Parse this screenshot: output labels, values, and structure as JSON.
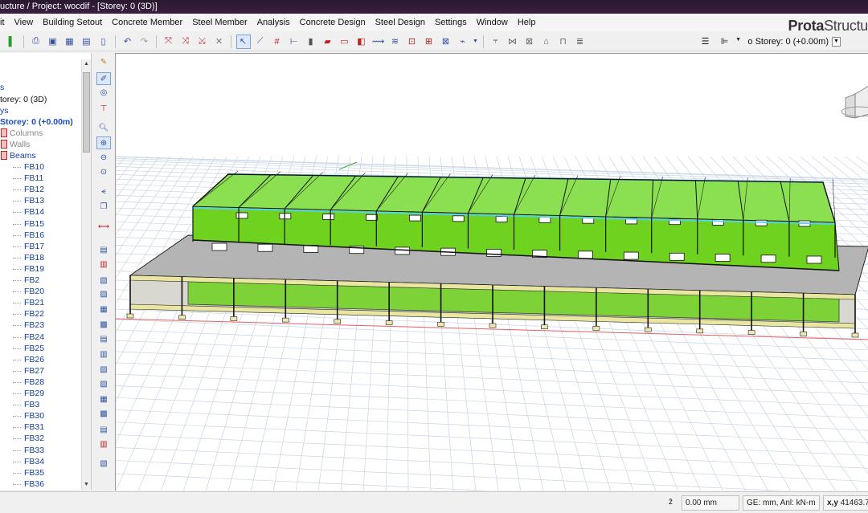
{
  "title_bar": {
    "text": "ucture / Project: wocdif - [Storey: 0 (3D)]"
  },
  "menu": {
    "items": [
      "it",
      "View",
      "Building Setout",
      "Concrete Member",
      "Steel Member",
      "Analysis",
      "Concrete Design",
      "Steel Design",
      "Settings",
      "Window",
      "Help"
    ]
  },
  "logo": {
    "bold": "Prota",
    "light": "Structu"
  },
  "toolbar": {
    "storey_label": "o  Storey: 0 (+0.00m)"
  },
  "tree": {
    "lines": [
      {
        "text": "s",
        "style": "blue"
      },
      {
        "text": "torey: 0 (3D)",
        "style": "black"
      },
      {
        "text": "ys",
        "style": "blue"
      },
      {
        "text": "Storey: 0 (+0.00m)",
        "style": "bold"
      },
      {
        "text": "Columns",
        "style": "grey"
      },
      {
        "text": "Walls",
        "style": "grey"
      },
      {
        "text": "Beams",
        "style": "blue"
      }
    ],
    "beams": [
      "FB10",
      "FB11",
      "FB12",
      "FB13",
      "FB14",
      "FB15",
      "FB16",
      "FB17",
      "FB18",
      "FB19",
      "FB2",
      "FB20",
      "FB21",
      "FB22",
      "FB23",
      "FB24",
      "FB25",
      "FB26",
      "FB27",
      "FB28",
      "FB29",
      "FB3",
      "FB30",
      "FB31",
      "FB32",
      "FB33",
      "FB34",
      "FB35",
      "FB36"
    ]
  },
  "status": {
    "elevation": "0.00 mm",
    "units": "GE: mm,  Anl: kN-m",
    "coord_label": "x,y",
    "coord_value": "41463.7"
  },
  "colors": {
    "wall_green": "#6ed21e",
    "slab_grey": "#b4b4b4",
    "beam_yellow": "#e8e6a0",
    "roof_cyan": "#5ad0e8",
    "grid_line": "#c8d4e4"
  }
}
